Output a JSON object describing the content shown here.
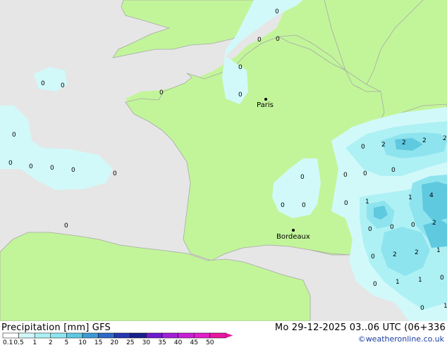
{
  "map": {
    "cities": [
      {
        "name": "Paris"
      },
      {
        "name": "Bordeaux"
      }
    ],
    "grid_values": [
      "0",
      "0",
      "0",
      "0",
      "0",
      "0",
      "0",
      "0",
      "0",
      "0",
      "0",
      "0",
      "0",
      "0",
      "0",
      "0",
      "0",
      "0",
      "0",
      "2",
      "2",
      "2",
      "2",
      "0",
      "1",
      "1",
      "4",
      "0",
      "0",
      "0",
      "2",
      "2",
      "2",
      "0",
      "1",
      "1",
      "0",
      "1",
      "1",
      "0",
      "0",
      "0",
      "0",
      "0"
    ]
  },
  "footer": {
    "title_left": "Precipitation [mm] GFS",
    "title_right": "Mo 29-12-2025 03..06 UTC (06+336",
    "credit": "©weatheronline.co.uk",
    "scale_labels": [
      "0.1",
      "0.5",
      "1",
      "2",
      "5",
      "10",
      "15",
      "20",
      "25",
      "30",
      "35",
      "40",
      "45",
      "50"
    ],
    "scale_colors": [
      "#ffffff",
      "#d2f9fa",
      "#aef1f4",
      "#8ee4ee",
      "#5fc9e0",
      "#3e9ad6",
      "#2f68c8",
      "#2538b0",
      "#181e8c",
      "#6c1bd0",
      "#a020d8",
      "#c820d8",
      "#e020c8",
      "#e8189e"
    ]
  }
}
